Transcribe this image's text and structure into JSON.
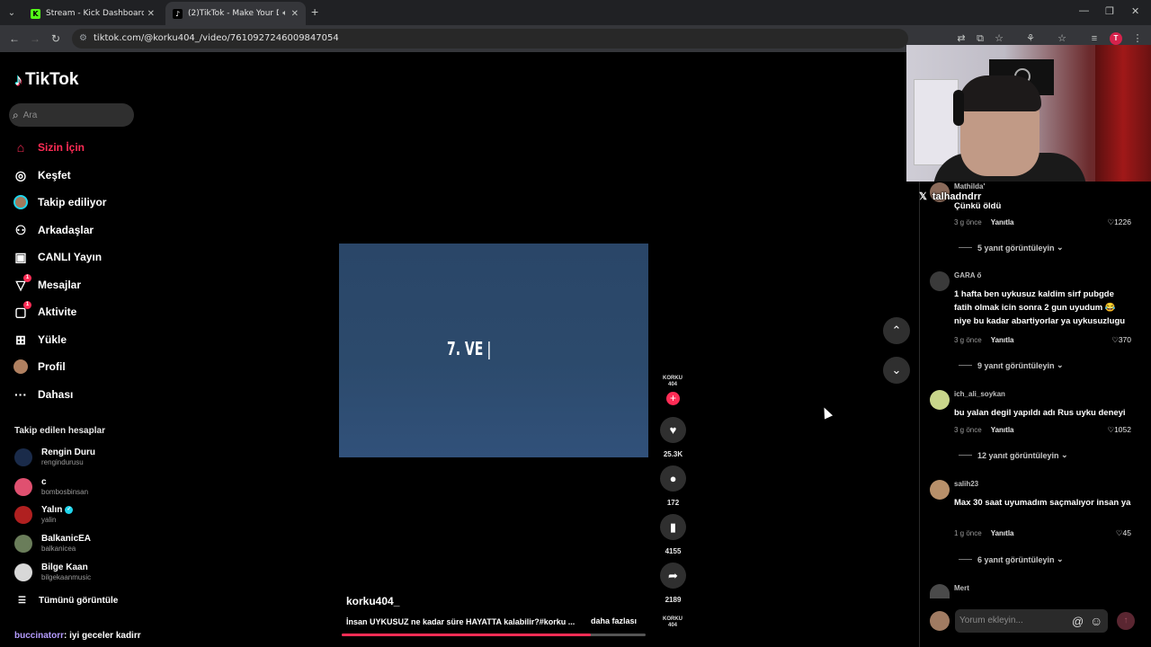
{
  "browser": {
    "tabs": [
      {
        "title": "Stream - Kick Dashboard",
        "active": false
      },
      {
        "title": "(2)TikTok - Make Your Day",
        "active": true
      }
    ],
    "url": "tiktok.com/@korku404_/video/7610927246009847054",
    "profile_initial": "T"
  },
  "sidebar": {
    "brand": "TikTok",
    "search_placeholder": "Ara",
    "nav": [
      {
        "label": "Sizin İçin",
        "icon": "home-icon",
        "active": true
      },
      {
        "label": "Keşfet",
        "icon": "compass-icon"
      },
      {
        "label": "Takip ediliyor",
        "icon": "following-icon"
      },
      {
        "label": "Arkadaşlar",
        "icon": "friends-icon"
      },
      {
        "label": "CANLI Yayın",
        "icon": "live-icon"
      },
      {
        "label": "Mesajlar",
        "icon": "messages-icon",
        "badge": "1"
      },
      {
        "label": "Aktivite",
        "icon": "activity-icon",
        "badge": "1"
      },
      {
        "label": "Yükle",
        "icon": "upload-icon"
      },
      {
        "label": "Profil",
        "icon": "profile-icon"
      },
      {
        "label": "Dahası",
        "icon": "more-icon"
      }
    ],
    "following_header": "Takip edilen hesaplar",
    "accounts": [
      {
        "name": "Rengin Duru",
        "handle": "rengindurusu",
        "color": "#1a2b4a"
      },
      {
        "name": "c",
        "handle": "bombosbinsan",
        "color": "#e05070"
      },
      {
        "name": "Yalın",
        "handle": "yalin",
        "verified": true,
        "color": "#b02020"
      },
      {
        "name": "BalkanicEA",
        "handle": "balkanicea",
        "color": "#6a7d5a"
      },
      {
        "name": "Bilge Kaan",
        "handle": "bilgekaanmusic",
        "color": "#d8d8d8"
      }
    ],
    "see_all": "Tümünü görüntüle"
  },
  "video": {
    "overlay_text": "7. VE",
    "author": "korku404_",
    "description": "İnsan UYKUSUZ ne kadar süre HAYATTA kalabilir?#korku ...",
    "more_label": "daha fazlası",
    "progress": 0.82,
    "creator_tag": "KORKU 404"
  },
  "actions": {
    "likes": "25.3K",
    "comments": "172",
    "saves": "4155",
    "shares": "2189"
  },
  "stream_overlay": {
    "streamer_handle": "talhadndrr",
    "chat_user": "buccinatorr",
    "chat_message": ": iyi geceler kadirr"
  },
  "comments": [
    {
      "user": "Mathilda'",
      "text": "Çünkü öldü",
      "time": "3 g önce",
      "reply": "Yanıtla",
      "likes": "1226",
      "replies": "5 yanıt görüntüleyin",
      "color": "#8a6a5a"
    },
    {
      "user": "GARA ő",
      "text": "1 hafta ben uykusuz kaldim sirf pubgde fatih olmak icin sonra 2 gun uyudum 😂 niye bu kadar abartiyorlar ya uykusuzlugu",
      "time": "3 g önce",
      "reply": "Yanıtla",
      "likes": "370",
      "replies": "9 yanıt görüntüleyin",
      "color": "#3a3a3a"
    },
    {
      "user": "ich_ali_soykan",
      "text": "bu yalan degil yapıldı adı Rus uyku deneyi",
      "time": "3 g önce",
      "reply": "Yanıtla",
      "likes": "1052",
      "replies": "12 yanıt görüntüleyin",
      "color": "#c9d68a"
    },
    {
      "user": "salih23",
      "text": "Max 30 saat uyumadım saçmalıyor insan ya",
      "time": "1 g önce",
      "reply": "Yanıtla",
      "likes": "45",
      "replies": "6 yanıt görüntüleyin",
      "color": "#b8906a"
    },
    {
      "user": "Mert",
      "color": "#4a4a4a"
    }
  ],
  "comment_input": {
    "placeholder": "Yorum ekleyin..."
  }
}
